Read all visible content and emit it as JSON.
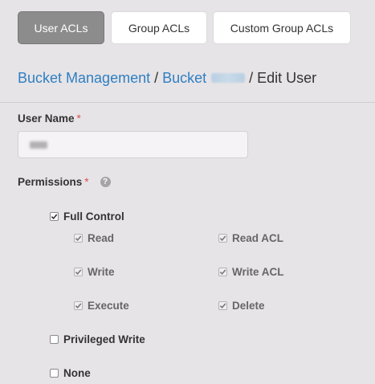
{
  "tabs": {
    "user_acls": "User ACLs",
    "group_acls": "Group ACLs",
    "custom_group_acls": "Custom Group ACLs"
  },
  "breadcrumb": {
    "bucket_management": "Bucket Management",
    "separator": "/",
    "bucket": "Bucket",
    "current": "Edit User"
  },
  "form": {
    "username_label": "User Name",
    "required_mark": "*",
    "permissions_label": "Permissions",
    "help_glyph": "?"
  },
  "permissions": {
    "full_control": {
      "label": "Full Control",
      "checked": true
    },
    "read": {
      "label": "Read",
      "checked": true,
      "disabled": true
    },
    "read_acl": {
      "label": "Read ACL",
      "checked": true,
      "disabled": true
    },
    "write": {
      "label": "Write",
      "checked": true,
      "disabled": true
    },
    "write_acl": {
      "label": "Write ACL",
      "checked": true,
      "disabled": true
    },
    "execute": {
      "label": "Execute",
      "checked": true,
      "disabled": true
    },
    "delete": {
      "label": "Delete",
      "checked": true,
      "disabled": true
    },
    "privileged_write": {
      "label": "Privileged Write",
      "checked": false
    },
    "none": {
      "label": "None",
      "checked": false
    }
  },
  "colors": {
    "background": "#e7e4e7",
    "active_tab": "#8c8c8c",
    "link": "#2f7fc2",
    "required": "#d9534f"
  }
}
